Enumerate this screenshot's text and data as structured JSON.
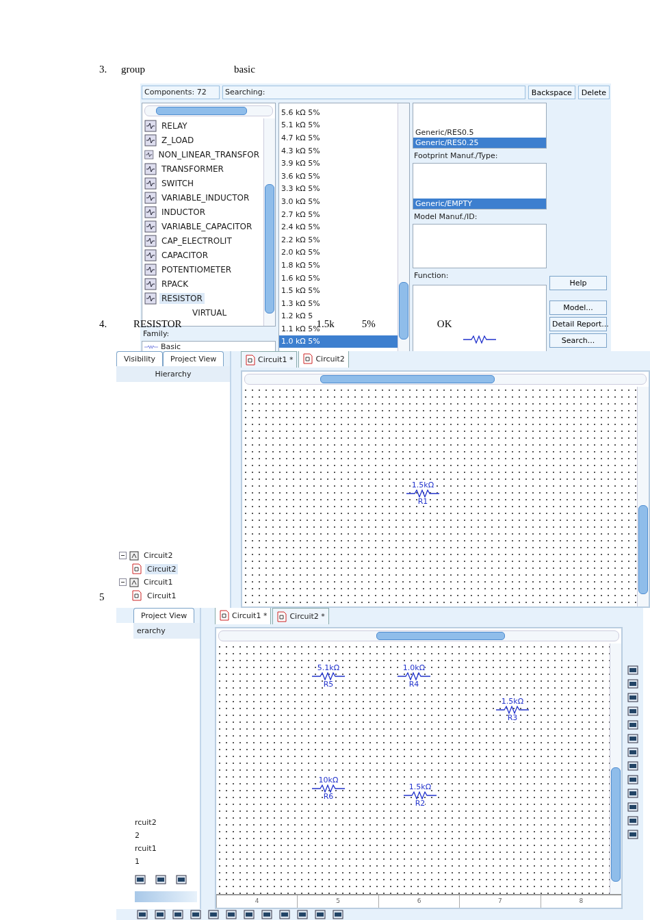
{
  "step3": {
    "number": "3.",
    "words": [
      "group",
      "basic"
    ]
  },
  "component_browser": {
    "components_count": "Components: 72",
    "searching": "Searching:",
    "buttons": [
      "Backspace",
      "Delete"
    ],
    "family_list": [
      {
        "label": "RELAY",
        "selected": false
      },
      {
        "label": "Z_LOAD",
        "selected": false
      },
      {
        "label": "NON_LINEAR_TRANSFOR",
        "selected": false
      },
      {
        "label": "TRANSFORMER",
        "selected": false
      },
      {
        "label": "SWITCH",
        "selected": false
      },
      {
        "label": "VARIABLE_INDUCTOR",
        "selected": false
      },
      {
        "label": "INDUCTOR",
        "selected": false
      },
      {
        "label": "VARIABLE_CAPACITOR",
        "selected": false
      },
      {
        "label": "CAP_ELECTROLIT",
        "selected": false
      },
      {
        "label": "CAPACITOR",
        "selected": false
      },
      {
        "label": "POTENTIOMETER",
        "selected": false
      },
      {
        "label": "RPACK",
        "selected": false
      },
      {
        "label": "RESISTOR",
        "selected": true
      },
      {
        "label": "VIRTUAL",
        "selected": false
      }
    ],
    "family_label": "Family:",
    "family_value": "Basic",
    "component_list": [
      {
        "label": "5.6 kΩ 5%",
        "selected": false
      },
      {
        "label": "5.1 kΩ 5%",
        "selected": false
      },
      {
        "label": "4.7 kΩ 5%",
        "selected": false
      },
      {
        "label": "4.3 kΩ 5%",
        "selected": false
      },
      {
        "label": "3.9 kΩ 5%",
        "selected": false
      },
      {
        "label": "3.6 kΩ 5%",
        "selected": false
      },
      {
        "label": "3.3 kΩ 5%",
        "selected": false
      },
      {
        "label": "3.0 kΩ 5%",
        "selected": false
      },
      {
        "label": "2.7 kΩ 5%",
        "selected": false
      },
      {
        "label": "2.4 kΩ 5%",
        "selected": false
      },
      {
        "label": "2.2 kΩ 5%",
        "selected": false
      },
      {
        "label": "2.0 kΩ 5%",
        "selected": false
      },
      {
        "label": "1.8 kΩ 5%",
        "selected": false
      },
      {
        "label": "1.6 kΩ 5%",
        "selected": false
      },
      {
        "label": "1.5 kΩ 5%",
        "selected": false
      },
      {
        "label": "1.3 kΩ 5%",
        "selected": false
      },
      {
        "label": "1.2 kΩ 5",
        "selected": false
      },
      {
        "label": "1.1 kΩ 5%",
        "selected": false
      },
      {
        "label": "1.0 kΩ 5%",
        "selected": true
      }
    ],
    "footprints": [
      {
        "label": "Generic/RES0.5",
        "selected": false
      },
      {
        "label": "Generic/RES0.25",
        "selected": true
      }
    ],
    "footprint_label": "Footprint Manuf./Type:",
    "models": [
      {
        "label": "Generic/EMPTY",
        "selected": true
      }
    ],
    "model_label": "Model Manuf./ID:",
    "function_label": "Function:",
    "side_buttons": [
      "Help",
      "Model...",
      "Detail Report...",
      "Search..."
    ]
  },
  "step4": {
    "number": "4.",
    "words": [
      "RESISTOR",
      "1.5k",
      "5%",
      "OK"
    ]
  },
  "design_window_1": {
    "panel_tabs": [
      {
        "label": "Visibility",
        "selected": false
      },
      {
        "label": "Project View",
        "selected": false
      },
      {
        "label": "Hierarchy",
        "selected": true
      }
    ],
    "tree": [
      {
        "label": "Circuit2",
        "expanded": true,
        "selected": false,
        "children": [
          {
            "label": "Circuit2",
            "selected": true
          }
        ]
      },
      {
        "label": "Circuit1",
        "expanded": true,
        "selected": false,
        "children": [
          {
            "label": "Circuit1",
            "selected": false
          }
        ]
      }
    ],
    "doc_tabs": [
      {
        "label": "Circuit1 *",
        "selected": false
      },
      {
        "label": "Circuit2",
        "selected": true
      }
    ],
    "resistors": [
      {
        "value": "1.5kΩ",
        "ref": "R1"
      }
    ]
  },
  "step5": {
    "number": "5"
  },
  "design_window_2": {
    "panel_tabs": [
      {
        "label": "Project View",
        "selected": false
      },
      {
        "label": "erarchy",
        "selected": true
      }
    ],
    "tree_fragments": [
      "rcuit2",
      "2",
      "rcuit1",
      "1"
    ],
    "doc_tabs": [
      {
        "label": "Circuit1 *",
        "selected": true
      },
      {
        "label": "Circuit2 *",
        "selected": false
      }
    ],
    "resistors": [
      {
        "value": "5.1kΩ",
        "ref": "R5"
      },
      {
        "value": "1.0kΩ",
        "ref": "R4"
      },
      {
        "value": "1.5kΩ",
        "ref": "R3"
      },
      {
        "value": "10kΩ",
        "ref": "R6"
      },
      {
        "value": "1.5kΩ",
        "ref": "R2"
      }
    ],
    "ruler": [
      "4",
      "5",
      "6",
      "7",
      "8"
    ]
  }
}
